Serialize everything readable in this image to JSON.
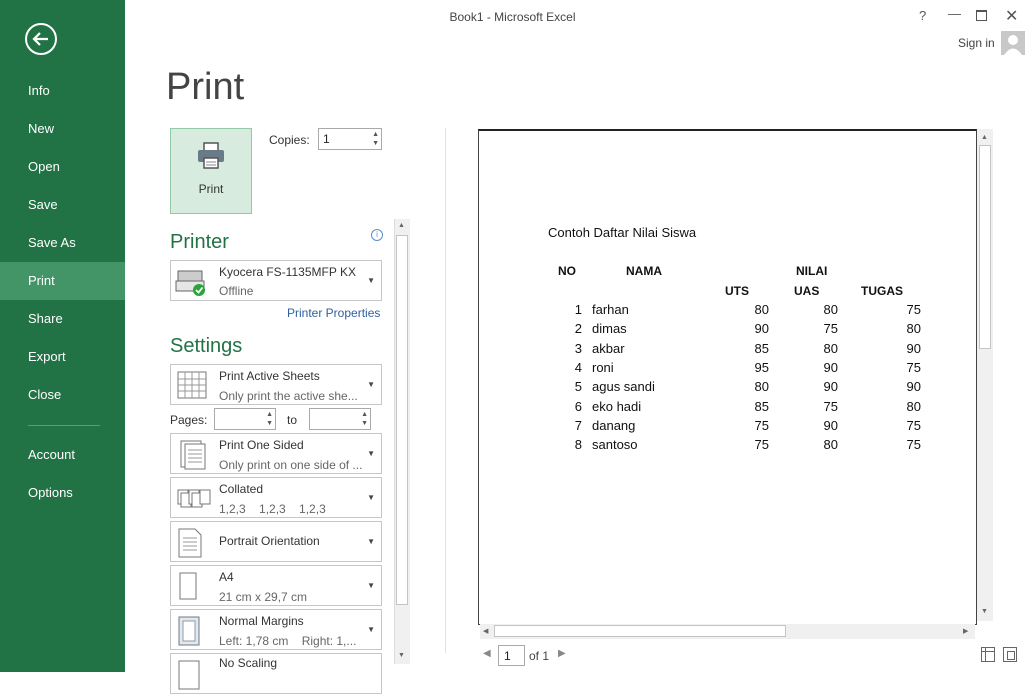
{
  "window": {
    "title": "Book1 - Microsoft Excel",
    "help": "?",
    "sign_in": "Sign in"
  },
  "nav": {
    "items": [
      {
        "label": "Info"
      },
      {
        "label": "New"
      },
      {
        "label": "Open"
      },
      {
        "label": "Save"
      },
      {
        "label": "Save As"
      },
      {
        "label": "Print",
        "active": true
      },
      {
        "label": "Share"
      },
      {
        "label": "Export"
      },
      {
        "label": "Close"
      },
      {
        "label": "Account"
      },
      {
        "label": "Options"
      }
    ]
  },
  "print": {
    "heading": "Print",
    "button_label": "Print",
    "copies_label": "Copies:",
    "copies_value": "1"
  },
  "printer": {
    "heading": "Printer",
    "name": "Kyocera FS-1135MFP KX",
    "status": "Offline",
    "properties_link": "Printer Properties"
  },
  "settings": {
    "heading": "Settings",
    "sheets": {
      "main": "Print Active Sheets",
      "sub": "Only print the active she..."
    },
    "pages_label": "Pages:",
    "pages_to": "to",
    "sides": {
      "main": "Print One Sided",
      "sub": "Only print on one side of ..."
    },
    "collation": {
      "main": "Collated",
      "sub": "1,2,3    1,2,3    1,2,3"
    },
    "orientation": {
      "main": "Portrait Orientation"
    },
    "paper": {
      "main": "A4",
      "sub": "21 cm x 29,7 cm"
    },
    "margins": {
      "main": "Normal Margins",
      "sub": "Left: 1,78 cm    Right: 1,..."
    },
    "scaling": {
      "main": "No Scaling"
    }
  },
  "preview": {
    "sheet_title": "Contoh Daftar Nilai Siswa",
    "headers": {
      "no": "NO",
      "nama": "NAMA",
      "nilai": "NILAI",
      "uts": "UTS",
      "uas": "UAS",
      "tugas": "TUGAS"
    },
    "rows": [
      {
        "no": "1",
        "nama": "farhan",
        "uts": "80",
        "uas": "80",
        "tugas": "75"
      },
      {
        "no": "2",
        "nama": "dimas",
        "uts": "90",
        "uas": "75",
        "tugas": "80"
      },
      {
        "no": "3",
        "nama": "akbar",
        "uts": "85",
        "uas": "80",
        "tugas": "90"
      },
      {
        "no": "4",
        "nama": "roni",
        "uts": "95",
        "uas": "90",
        "tugas": "75"
      },
      {
        "no": "5",
        "nama": "agus sandi",
        "uts": "80",
        "uas": "90",
        "tugas": "90"
      },
      {
        "no": "6",
        "nama": "eko hadi",
        "uts": "85",
        "uas": "75",
        "tugas": "80"
      },
      {
        "no": "7",
        "nama": "danang",
        "uts": "75",
        "uas": "90",
        "tugas": "75"
      },
      {
        "no": "8",
        "nama": "santoso",
        "uts": "75",
        "uas": "80",
        "tugas": "75"
      }
    ],
    "page_current": "1",
    "page_of": "of 1"
  }
}
